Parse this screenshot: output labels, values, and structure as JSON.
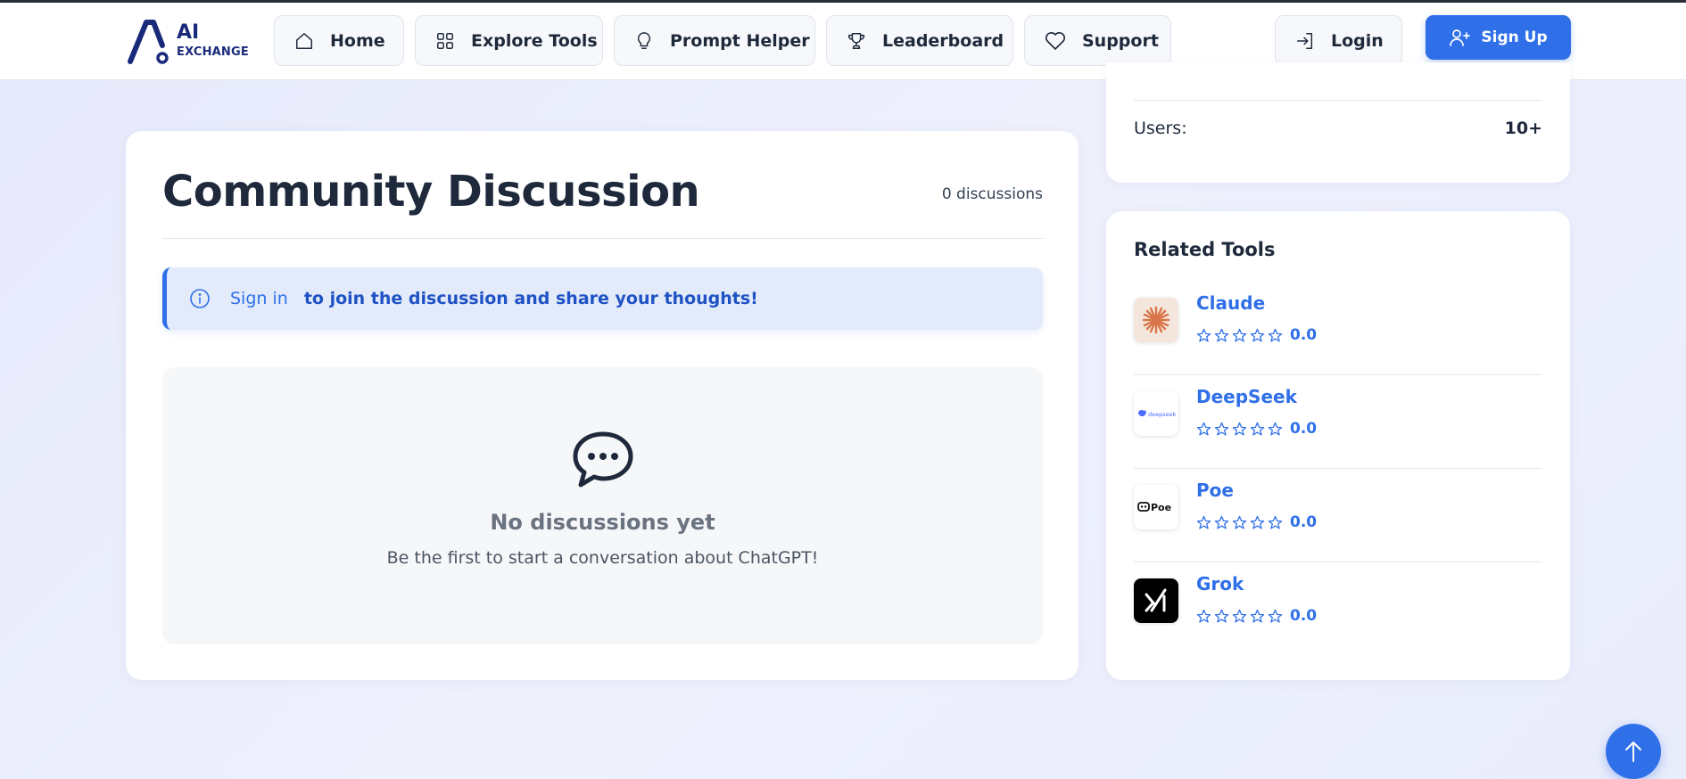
{
  "brand": {
    "line1": "AI",
    "line2": "EXCHANGE"
  },
  "nav": {
    "home": "Home",
    "explore": "Explore Tools",
    "prompt": "Prompt Helper",
    "leaderboard": "Leaderboard",
    "support": "Support",
    "login": "Login",
    "signup": "Sign Up"
  },
  "discussion": {
    "title": "Community Discussion",
    "count": "0 discussions",
    "signin_link": "Sign in",
    "signin_msg": "to join the discussion and share your thoughts!",
    "empty_title": "No discussions yet",
    "empty_sub": "Be the first to start a conversation about ChatGPT!"
  },
  "stats": {
    "users_label": "Users:",
    "users_value": "10+"
  },
  "related": {
    "title": "Related Tools",
    "tools": [
      {
        "name": "Claude",
        "rating": "0.0",
        "icon": "claude-logo"
      },
      {
        "name": "DeepSeek",
        "rating": "0.0",
        "icon": "deepseek-logo",
        "logo_text": "deepseek"
      },
      {
        "name": "Poe",
        "rating": "0.0",
        "icon": "poe-logo",
        "logo_text": "Poe"
      },
      {
        "name": "Grok",
        "rating": "0.0",
        "icon": "grok-logo"
      }
    ]
  },
  "colors": {
    "accent": "#2f6fe8",
    "brand": "#1a2a7a"
  }
}
